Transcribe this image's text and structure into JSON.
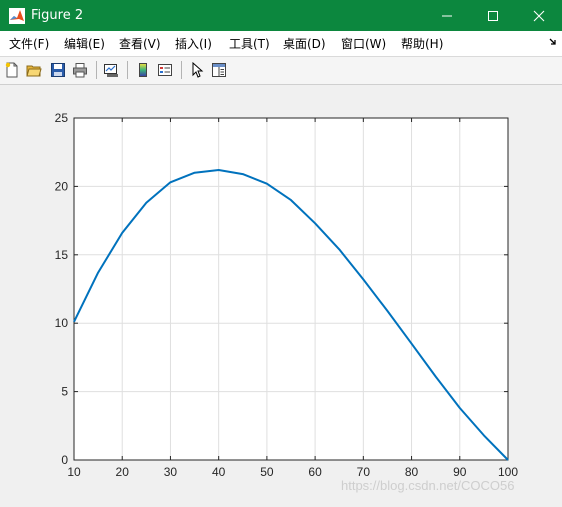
{
  "window": {
    "title": "Figure 2",
    "title_bar_color": "#0c873e",
    "controls": [
      "minimize-icon",
      "maximize-icon",
      "close-icon"
    ]
  },
  "menu": {
    "items": [
      {
        "label": "文件(F)"
      },
      {
        "label": "编辑(E)"
      },
      {
        "label": "查看(V)"
      },
      {
        "label": "插入(I)"
      },
      {
        "label": "工具(T)"
      },
      {
        "label": "桌面(D)"
      },
      {
        "label": "窗口(W)"
      },
      {
        "label": "帮助(H)"
      }
    ]
  },
  "toolbar": {
    "icons": [
      "new-figure-icon",
      "open-file-icon",
      "save-icon",
      "print-icon",
      "link-plot-icon",
      "insert-colorbar-icon",
      "insert-legend-icon",
      "edit-plot-icon",
      "property-inspector-icon"
    ]
  },
  "chart_data": {
    "type": "line",
    "title": "",
    "xlabel": "",
    "ylabel": "",
    "xlim": [
      10,
      100
    ],
    "ylim": [
      0,
      25
    ],
    "xticks": [
      10,
      20,
      30,
      40,
      50,
      60,
      70,
      80,
      90,
      100
    ],
    "yticks": [
      0,
      5,
      10,
      15,
      20,
      25
    ],
    "grid": true,
    "series": [
      {
        "color": "#0072bd",
        "x": [
          10,
          15,
          20,
          25,
          30,
          35,
          40,
          45,
          50,
          55,
          60,
          65,
          70,
          75,
          80,
          85,
          90,
          95,
          100
        ],
        "y": [
          10.1,
          13.7,
          16.6,
          18.8,
          20.3,
          21.0,
          21.2,
          20.9,
          20.2,
          19.0,
          17.3,
          15.4,
          13.2,
          10.9,
          8.5,
          6.1,
          3.8,
          1.8,
          0
        ]
      }
    ]
  },
  "watermark": "https://blog.csdn.net/COCO56"
}
